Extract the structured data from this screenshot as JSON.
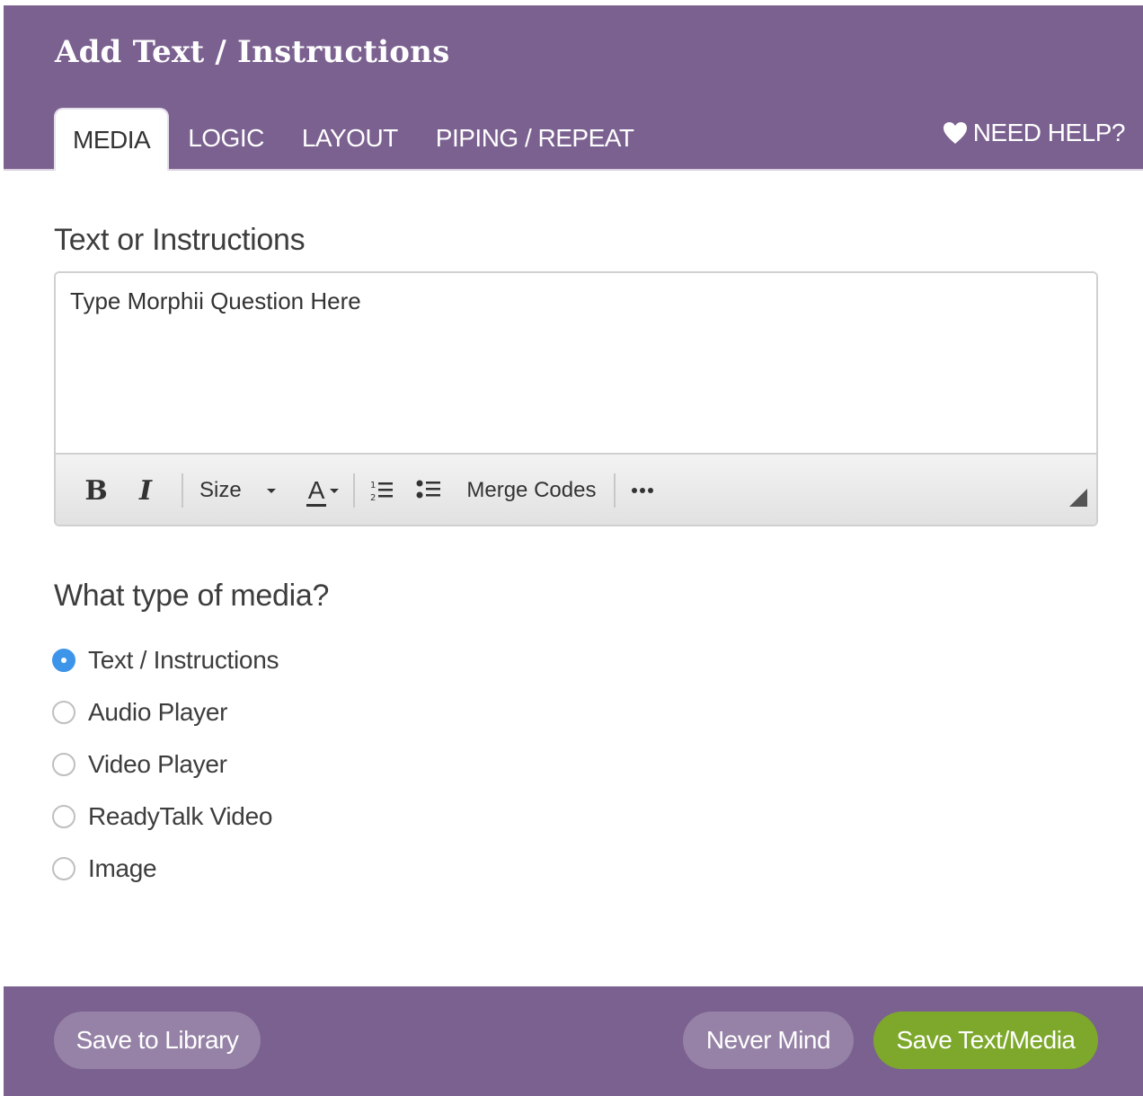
{
  "dialog": {
    "title": "Add Text / Instructions",
    "tabs": [
      {
        "label": "MEDIA",
        "active": true
      },
      {
        "label": "LOGIC",
        "active": false
      },
      {
        "label": "LAYOUT",
        "active": false
      },
      {
        "label": "PIPING / REPEAT",
        "active": false
      }
    ],
    "help_label": "NEED HELP?"
  },
  "text_section": {
    "label": "Text or Instructions",
    "editor_value": "Type Morphii Question Here",
    "toolbar": {
      "bold": "B",
      "italic": "I",
      "size_label": "Size",
      "font_color": "A",
      "merge_codes": "Merge Codes"
    }
  },
  "media_section": {
    "label": "What type of media?",
    "options": [
      {
        "label": "Text / Instructions",
        "checked": true
      },
      {
        "label": "Audio Player",
        "checked": false
      },
      {
        "label": "Video Player",
        "checked": false
      },
      {
        "label": "ReadyTalk Video",
        "checked": false
      },
      {
        "label": "Image",
        "checked": false
      }
    ]
  },
  "footer": {
    "save_library": "Save to Library",
    "never_mind": "Never Mind",
    "save_media": "Save Text/Media"
  },
  "colors": {
    "header_bg": "#7b6190",
    "primary_button": "#7da82b",
    "radio_checked": "#3d95ea"
  }
}
